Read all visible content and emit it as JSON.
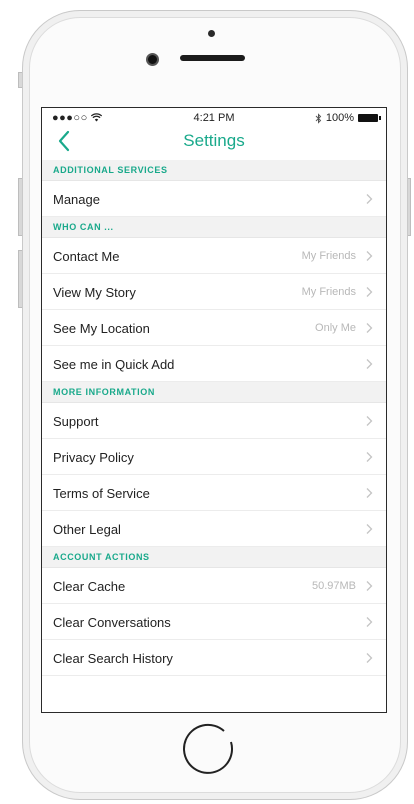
{
  "status_bar": {
    "signal": "●●●○○",
    "time": "4:21 PM",
    "battery_percent": "100%"
  },
  "nav": {
    "title": "Settings"
  },
  "sections": [
    {
      "header": "ADDITIONAL SERVICES",
      "rows": [
        {
          "label": "Manage",
          "value": ""
        }
      ]
    },
    {
      "header": "WHO CAN ...",
      "rows": [
        {
          "label": "Contact Me",
          "value": "My Friends"
        },
        {
          "label": "View My Story",
          "value": "My Friends"
        },
        {
          "label": "See My Location",
          "value": "Only Me"
        },
        {
          "label": "See me in Quick Add",
          "value": ""
        }
      ]
    },
    {
      "header": "MORE INFORMATION",
      "rows": [
        {
          "label": "Support",
          "value": ""
        },
        {
          "label": "Privacy Policy",
          "value": ""
        },
        {
          "label": "Terms of Service",
          "value": ""
        },
        {
          "label": "Other Legal",
          "value": ""
        }
      ]
    },
    {
      "header": "ACCOUNT ACTIONS",
      "rows": [
        {
          "label": "Clear Cache",
          "value": "50.97MB"
        },
        {
          "label": "Clear Conversations",
          "value": ""
        },
        {
          "label": "Clear Search History",
          "value": ""
        }
      ]
    }
  ],
  "colors": {
    "accent": "#19a98b",
    "section_bg": "#f2f2f2",
    "value_text": "#b8b8b8"
  }
}
